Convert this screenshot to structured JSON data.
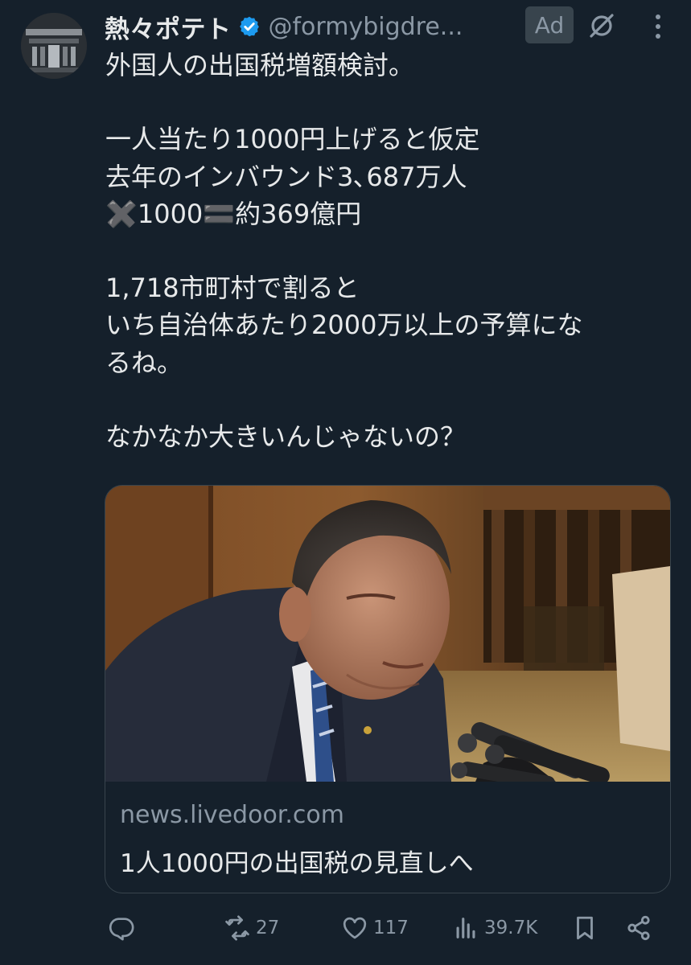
{
  "author": {
    "display_name": "熱々ポテト",
    "handle": "@formybigdre...",
    "verified": true
  },
  "ad_badge": "Ad",
  "tweet_text": "外国人の出国税増額検討。\n\n一人当たり1000円上げると仮定\n去年のインバウンド3､687万人\n✖️1000🟰約369億円\n\n1,718市町村で割ると\nいち自治体あたり2000万以上の予算にな\nるね。\n\nなかなか大きいんじゃないの？",
  "card": {
    "domain": "news.livedoor.com",
    "title": "1人1000円の出国税の見直しへ"
  },
  "actions": {
    "reply_count": "",
    "retweet_count": "27",
    "like_count": "117",
    "views_count": "39.7K"
  },
  "colors": {
    "background": "#15202b",
    "text": "#e7e9ea",
    "muted": "#8b98a5",
    "verified": "#1d9bf0",
    "border": "#38444d"
  },
  "icons": {
    "verified": "verified-badge-icon",
    "hide": "hide-ad-icon",
    "more": "more-vertical-icon",
    "reply": "reply-icon",
    "retweet": "retweet-icon",
    "like": "heart-icon",
    "views": "views-chart-icon",
    "bookmark": "bookmark-icon",
    "share": "share-icon"
  }
}
